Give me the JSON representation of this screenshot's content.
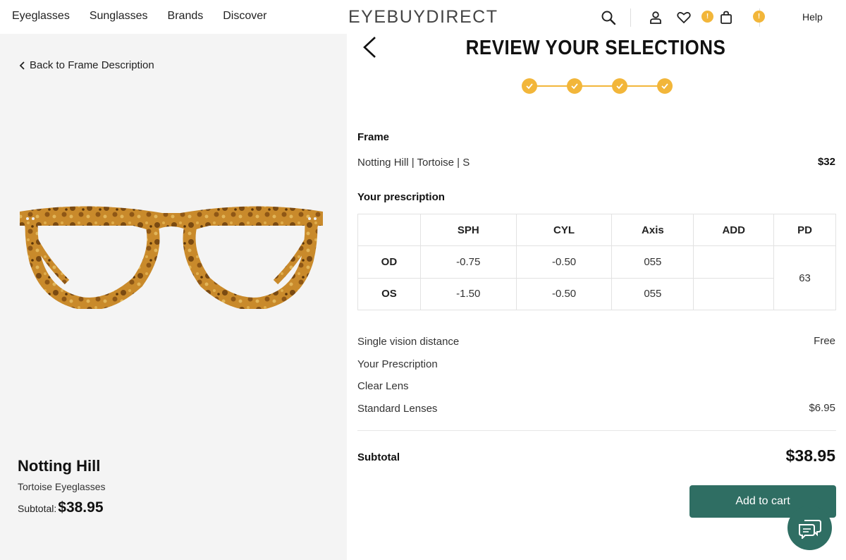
{
  "header": {
    "nav": [
      "Eyeglasses",
      "Sunglasses",
      "Brands",
      "Discover"
    ],
    "logo": "EYEBUYDIRECT",
    "favorites_badge": "!",
    "cart_badge": "!",
    "help": "Help",
    "icons": [
      "search-icon",
      "account-icon",
      "heart-icon",
      "bag-icon"
    ]
  },
  "left": {
    "back_label": "Back to Frame Description",
    "product_name": "Notting Hill",
    "product_type": "Tortoise Eyeglasses",
    "subtotal_label": "Subtotal:",
    "subtotal_amount": "$38.95"
  },
  "review": {
    "title": "REVIEW YOUR SELECTIONS",
    "steps_completed": 4,
    "frame_label": "Frame",
    "frame_desc": "Notting Hill | Tortoise | S",
    "frame_price": "$32",
    "prescription_label": "Your prescription",
    "rx_table": {
      "headers": [
        "",
        "SPH",
        "CYL",
        "Axis",
        "ADD",
        "PD"
      ],
      "rows": [
        {
          "eye": "OD",
          "sph": "-0.75",
          "cyl": "-0.50",
          "axis": "055",
          "add": ""
        },
        {
          "eye": "OS",
          "sph": "-1.50",
          "cyl": "-0.50",
          "axis": "055",
          "add": ""
        }
      ],
      "pd": "63"
    },
    "lens_items": [
      {
        "label": "Single vision distance",
        "price": "Free"
      },
      {
        "label": "Your Prescription",
        "price": ""
      },
      {
        "label": "Clear Lens",
        "price": ""
      },
      {
        "label": "Standard Lenses",
        "price": "$6.95"
      }
    ],
    "subtotal_label": "Subtotal",
    "subtotal_amount": "$38.95",
    "add_to_cart": "Add to cart"
  },
  "colors": {
    "accent_yellow": "#f2b63a",
    "button_green": "#2f6e63"
  }
}
